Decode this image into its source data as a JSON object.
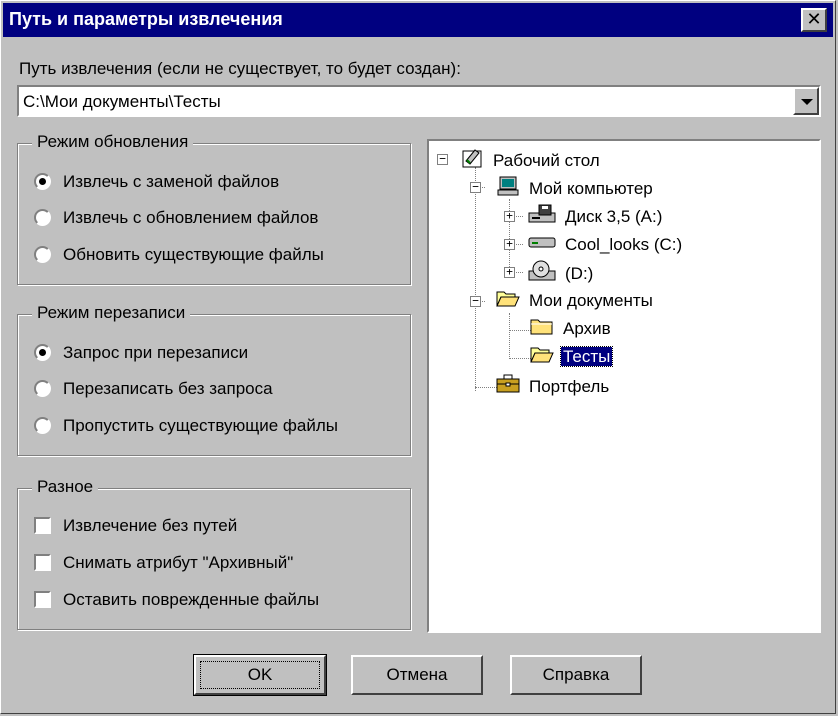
{
  "window": {
    "title": "Путь и параметры извлечения",
    "close_label": "✕"
  },
  "path": {
    "label": "Путь извлечения (если не существует, то будет создан):",
    "value": "C:\\Мои документы\\Тесты"
  },
  "update_mode": {
    "legend": "Режим обновления",
    "options": [
      {
        "label": "Извлечь с заменой файлов",
        "checked": true
      },
      {
        "label": "Извлечь с обновлением файлов",
        "checked": false
      },
      {
        "label": "Обновить существующие файлы",
        "checked": false
      }
    ]
  },
  "overwrite_mode": {
    "legend": "Режим перезаписи",
    "options": [
      {
        "label": "Запрос при перезаписи",
        "checked": true
      },
      {
        "label": "Перезаписать без запроса",
        "checked": false
      },
      {
        "label": "Пропустить существующие файлы",
        "checked": false
      }
    ]
  },
  "misc": {
    "legend": "Разное",
    "options": [
      {
        "label": "Извлечение без путей",
        "checked": false
      },
      {
        "label": "Снимать атрибут \"Архивный\"",
        "checked": false
      },
      {
        "label": "Оставить поврежденные файлы",
        "checked": false
      }
    ]
  },
  "tree": {
    "nodes": [
      {
        "label": "Рабочий стол",
        "icon": "desktop-icon",
        "expander": "−"
      },
      {
        "label": "Мой компьютер",
        "icon": "computer-icon",
        "expander": "−"
      },
      {
        "label": "Диск 3,5 (A:)",
        "icon": "floppy-drive-icon",
        "expander": "+"
      },
      {
        "label": "Cool_looks (C:)",
        "icon": "hard-drive-icon",
        "expander": "+"
      },
      {
        "label": "(D:)",
        "icon": "cd-drive-icon",
        "expander": "+"
      },
      {
        "label": "Мои документы",
        "icon": "open-folder-icon",
        "expander": "−"
      },
      {
        "label": "Архив",
        "icon": "folder-icon",
        "expander": ""
      },
      {
        "label": "Тесты",
        "icon": "open-folder-icon",
        "expander": "",
        "selected": true
      },
      {
        "label": "Портфель",
        "icon": "briefcase-icon",
        "expander": ""
      }
    ]
  },
  "buttons": {
    "ok": "OK",
    "cancel": "Отмена",
    "help": "Справка"
  },
  "colors": {
    "title_bar": "#000080",
    "face": "#c0c0c0",
    "selection": "#000080"
  }
}
